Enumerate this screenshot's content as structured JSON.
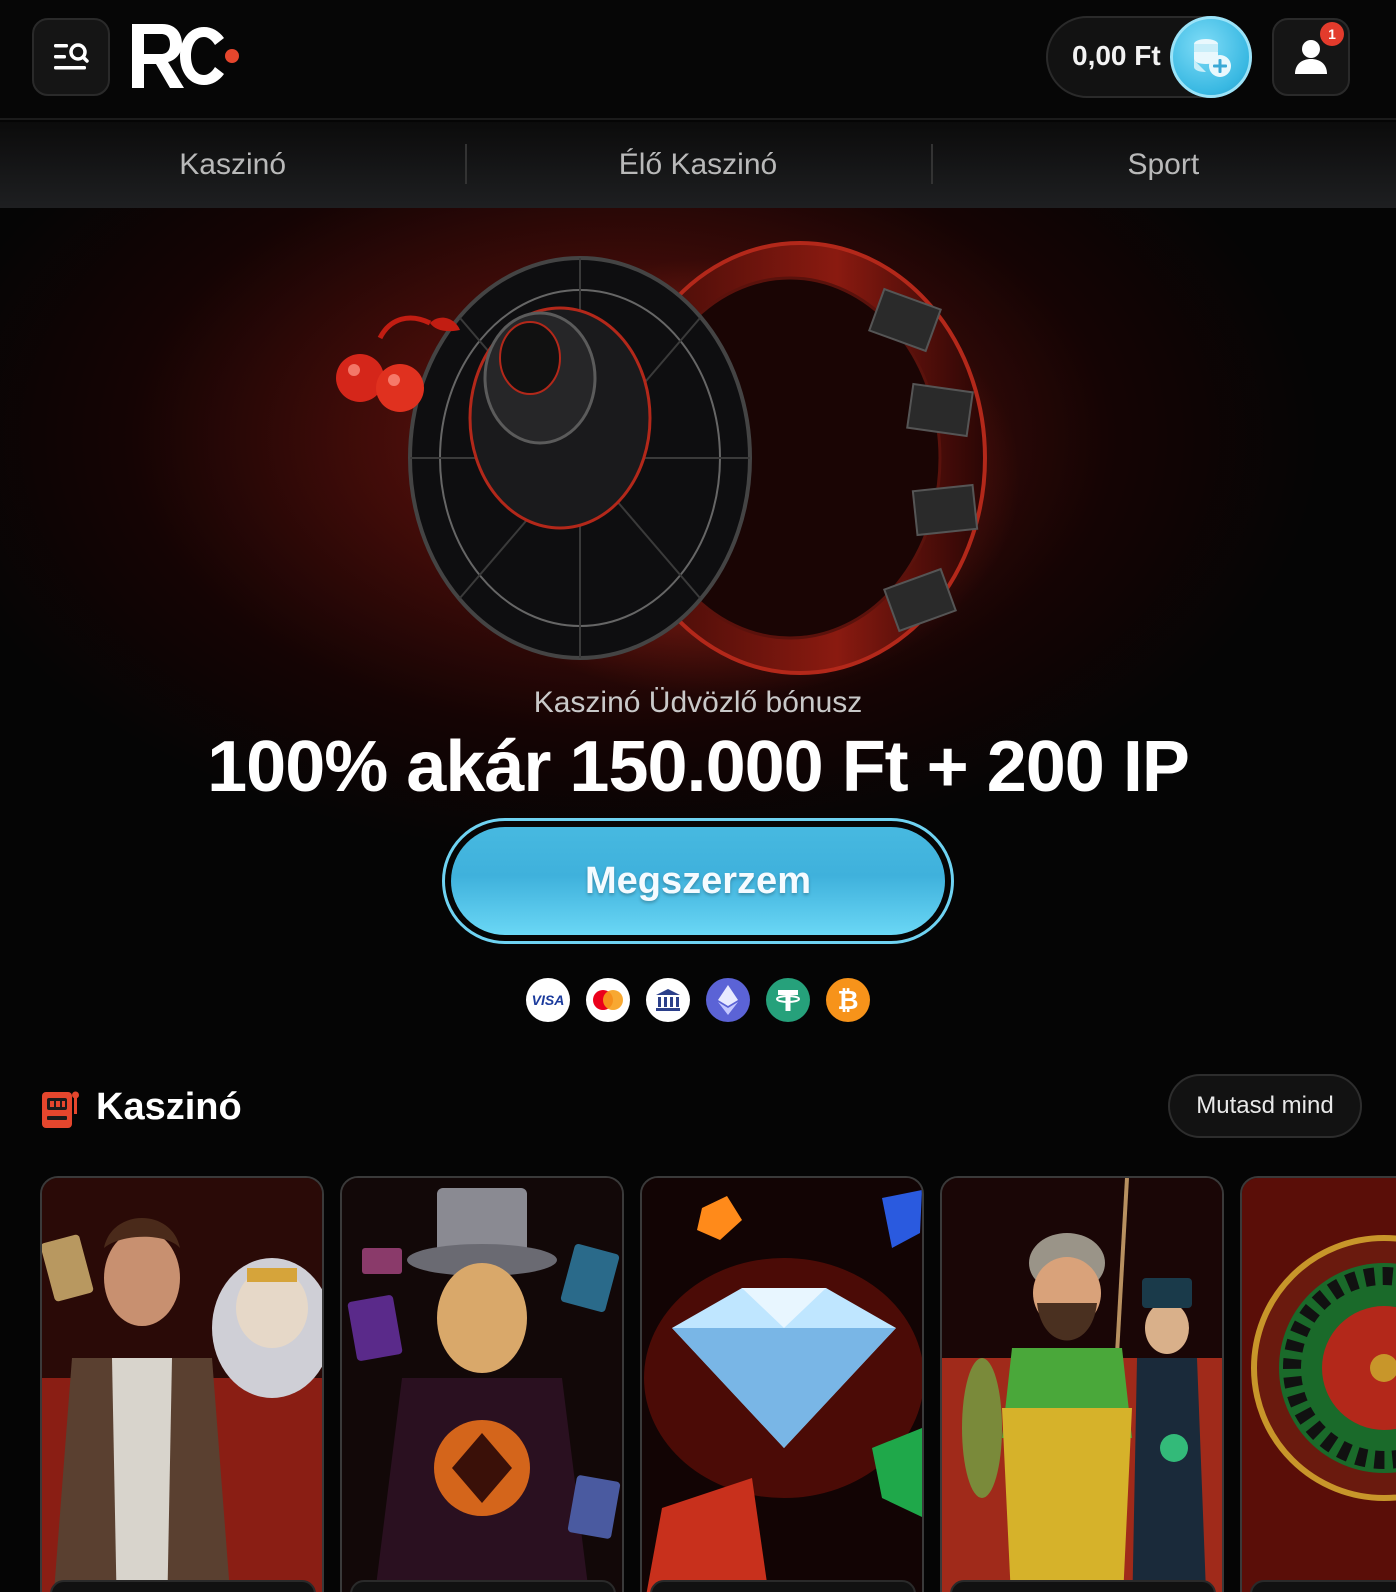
{
  "header": {
    "balance": "0,00 Ft",
    "notification_count": "1",
    "icons": {
      "menu": "menu-search-icon",
      "deposit": "coins-plus-icon",
      "user": "user-icon"
    }
  },
  "nav": {
    "items": [
      "Kaszinó",
      "Élő Kaszinó",
      "Sport"
    ]
  },
  "hero": {
    "subtitle": "Kaszinó Üdvözlő bónusz",
    "title": "100% akár 150.000 Ft + 200 IP",
    "cta": "Megszerzem",
    "payments": [
      {
        "name": "visa-icon",
        "label": "VISA"
      },
      {
        "name": "mastercard-icon"
      },
      {
        "name": "bank-icon"
      },
      {
        "name": "ethereum-icon"
      },
      {
        "name": "tether-icon"
      },
      {
        "name": "bitcoin-icon"
      }
    ]
  },
  "casino": {
    "title": "Kaszinó",
    "show_all": "Mutasd mind",
    "icon": "slot-machine-icon",
    "games": [
      {
        "name": "adventurer-and-zeus-game"
      },
      {
        "name": "magician-game"
      },
      {
        "name": "diamond-gems-game"
      },
      {
        "name": "fisherman-game"
      },
      {
        "name": "roulette-game"
      }
    ]
  },
  "colors": {
    "accent": "#3fb1dc",
    "brand_red": "#e5462d",
    "background": "#050505"
  }
}
